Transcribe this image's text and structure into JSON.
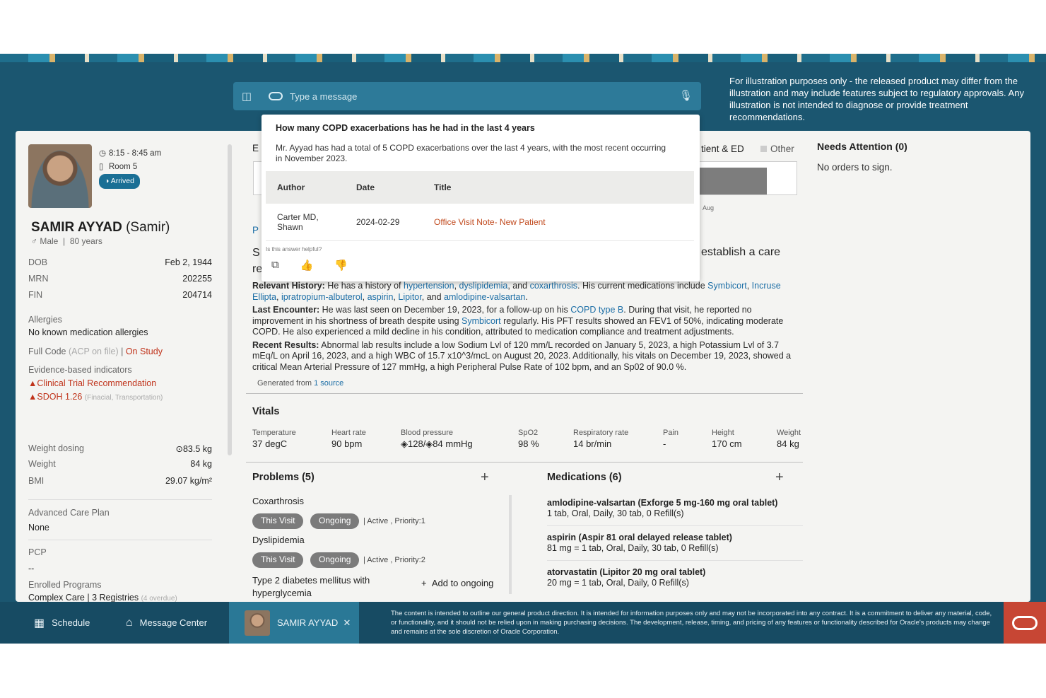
{
  "disclaimer_top": "For illustration purposes only - the released product may differ from the illustration and may include features subject to regulatory approvals. Any illustration is not intended to diagnose or provide treatment recommendations.",
  "search": {
    "placeholder": "Type a message"
  },
  "answer": {
    "question": "How many COPD exacerbations has he had in the last 4 years",
    "text": "Mr. Ayyad has had a total of 5 COPD exacerbations over the last 4 years, with the most recent occurring in November 2023.",
    "columns": [
      "Author",
      "Date",
      "Title"
    ],
    "row": {
      "author_line1": "Carter MD,",
      "author_line2": "Shawn",
      "date": "2024-02-29",
      "title": "Office Visit Note- New Patient"
    },
    "helpful": "Is this answer helpful?"
  },
  "patient": {
    "time": "8:15 - 8:45 am",
    "room": "Room 5",
    "status": "Arrived",
    "name": "SAMIR AYYAD",
    "nick": "(Samir)",
    "sex": "Male",
    "age": "80 years",
    "dob_label": "DOB",
    "dob": "Feb 2, 1944",
    "mrn_label": "MRN",
    "mrn": "202255",
    "fin_label": "FIN",
    "fin": "204714",
    "allergies_label": "Allergies",
    "allergies": "No known medication allergies",
    "code_status": "Full Code",
    "acp": "(ACP on file)",
    "study": "On Study",
    "ebi_label": "Evidence-based indicators",
    "ebi_1": "Clinical Trial Recommendation",
    "ebi_2": "SDOH 1.26",
    "ebi_2_note": "(Finacial, Transportation)",
    "wd_label": "Weight dosing",
    "wd": "83.5 kg",
    "weight_label": "Weight",
    "weight": "84 kg",
    "bmi_label": "BMI",
    "bmi": "29.07 kg/m²",
    "acp_label": "Advanced Care Plan",
    "acp_value": "None",
    "pcp_label": "PCP",
    "pcp_value": "--",
    "programs_label": "Enrolled Programs",
    "programs_value": "Complex Care",
    "programs_registries": "3 Registries",
    "programs_overdue": "(4 overdue)"
  },
  "partials": {
    "left_cut": "E",
    "tabs_right": "tient & ED",
    "other": "Other",
    "aug": "Aug",
    "care": "establish a care",
    "p_cut": "P",
    "s_cut": "S",
    "re_cut": "re"
  },
  "summary": {
    "history_label": "Relevant History:",
    "history_pre": "He has a history of",
    "hypertension": "hypertension",
    "dyslipidemia": "dyslipidemia",
    "and": "and",
    "coxarthrosis": "coxarthrosis",
    "meds_pre": "His current medications include",
    "symbicort": "Symbicort",
    "incruse": "Incruse Ellipta",
    "ipratropium": "ipratropium-albuterol",
    "aspirin": "aspirin",
    "lipitor": "Lipitor",
    "amlodipine": "amlodipine-valsartan",
    "last_label": "Last Encounter:",
    "last_pre": "He was last seen on December 19, 2023, for a follow-up on his",
    "copd": "COPD type B",
    "last_mid": "During that visit, he reported no improvement in his shortness of breath despite using",
    "last_post": "regularly. His PFT results showed an FEV1 of 50%, indicating moderate COPD. He also experienced a mild decline in his condition, attributed to medication compliance and treatment adjustments.",
    "recent_label": "Recent Results:",
    "recent_text": "Abnormal lab results include a low Sodium Lvl of 120 mm/L recorded on January 5, 2023, a high Potassium Lvl of 3.7 mEq/L on April 16, 2023, and a high WBC of 15.7 x10^3/mcL on August 20, 2023. Additionally, his vitals on December 19, 2023, showed a critical Mean Arterial Pressure of 127 mmHg, a high Peripheral Pulse Rate of 102 bpm, and an Sp02 of 90.0 %.",
    "generated": "Generated from",
    "source": "1 source"
  },
  "vitals": {
    "title": "Vitals",
    "items": [
      {
        "label": "Temperature",
        "value": "37 degC"
      },
      {
        "label": "Heart rate",
        "value": "90 bpm"
      },
      {
        "label": "Blood pressure",
        "value": "◈128/◈84 mmHg"
      },
      {
        "label": "SpO2",
        "value": "98 %"
      },
      {
        "label": "Respiratory rate",
        "value": "14 br/min"
      },
      {
        "label": "Pain",
        "value": "-"
      },
      {
        "label": "Height",
        "value": "170 cm"
      },
      {
        "label": "Weight",
        "value": "84 kg"
      }
    ]
  },
  "problems": {
    "title": "Problems (5)",
    "this_visit": "This Visit",
    "ongoing": "Ongoing",
    "items": [
      {
        "name": "Coxarthrosis",
        "meta": "| Active , Priority:1"
      },
      {
        "name": "Dyslipidemia",
        "meta": "| Active , Priority:2"
      },
      {
        "name": "Type 2 diabetes mellitus with hyperglycemia"
      }
    ],
    "add_ongoing": "Add to ongoing"
  },
  "medications": {
    "title": "Medications (6)",
    "items": [
      {
        "name": "amlodipine-valsartan (Exforge 5 mg-160 mg oral tablet)",
        "sig": "1 tab, Oral, Daily, 30 tab, 0 Refill(s)"
      },
      {
        "name": "aspirin (Aspir 81 oral delayed release tablet)",
        "sig": "81 mg = 1 tab, Oral, Daily, 30 tab, 0 Refill(s)"
      },
      {
        "name": "atorvastatin (Lipitor 20 mg oral tablet)",
        "sig": "20 mg = 1 tab, Oral, Daily, 0 Refill(s)"
      }
    ]
  },
  "needs": {
    "title": "Needs Attention (0)",
    "empty": "No orders to sign."
  },
  "bottom": {
    "schedule": "Schedule",
    "message_center": "Message Center",
    "patient_tab": "SAMIR AYYAD",
    "close": "✕",
    "legal": "The content is intended to outline our general product direction. It is intended for information purposes only and may not be incorporated into any contract. It is a commitment to deliver any material, code, or functionality, and it should not be relied upon in making purchasing decisions. The development, release, timing, and pricing of any features or functionality described for Oracle's products may change and remains at the sole discretion of Oracle Corporation."
  }
}
